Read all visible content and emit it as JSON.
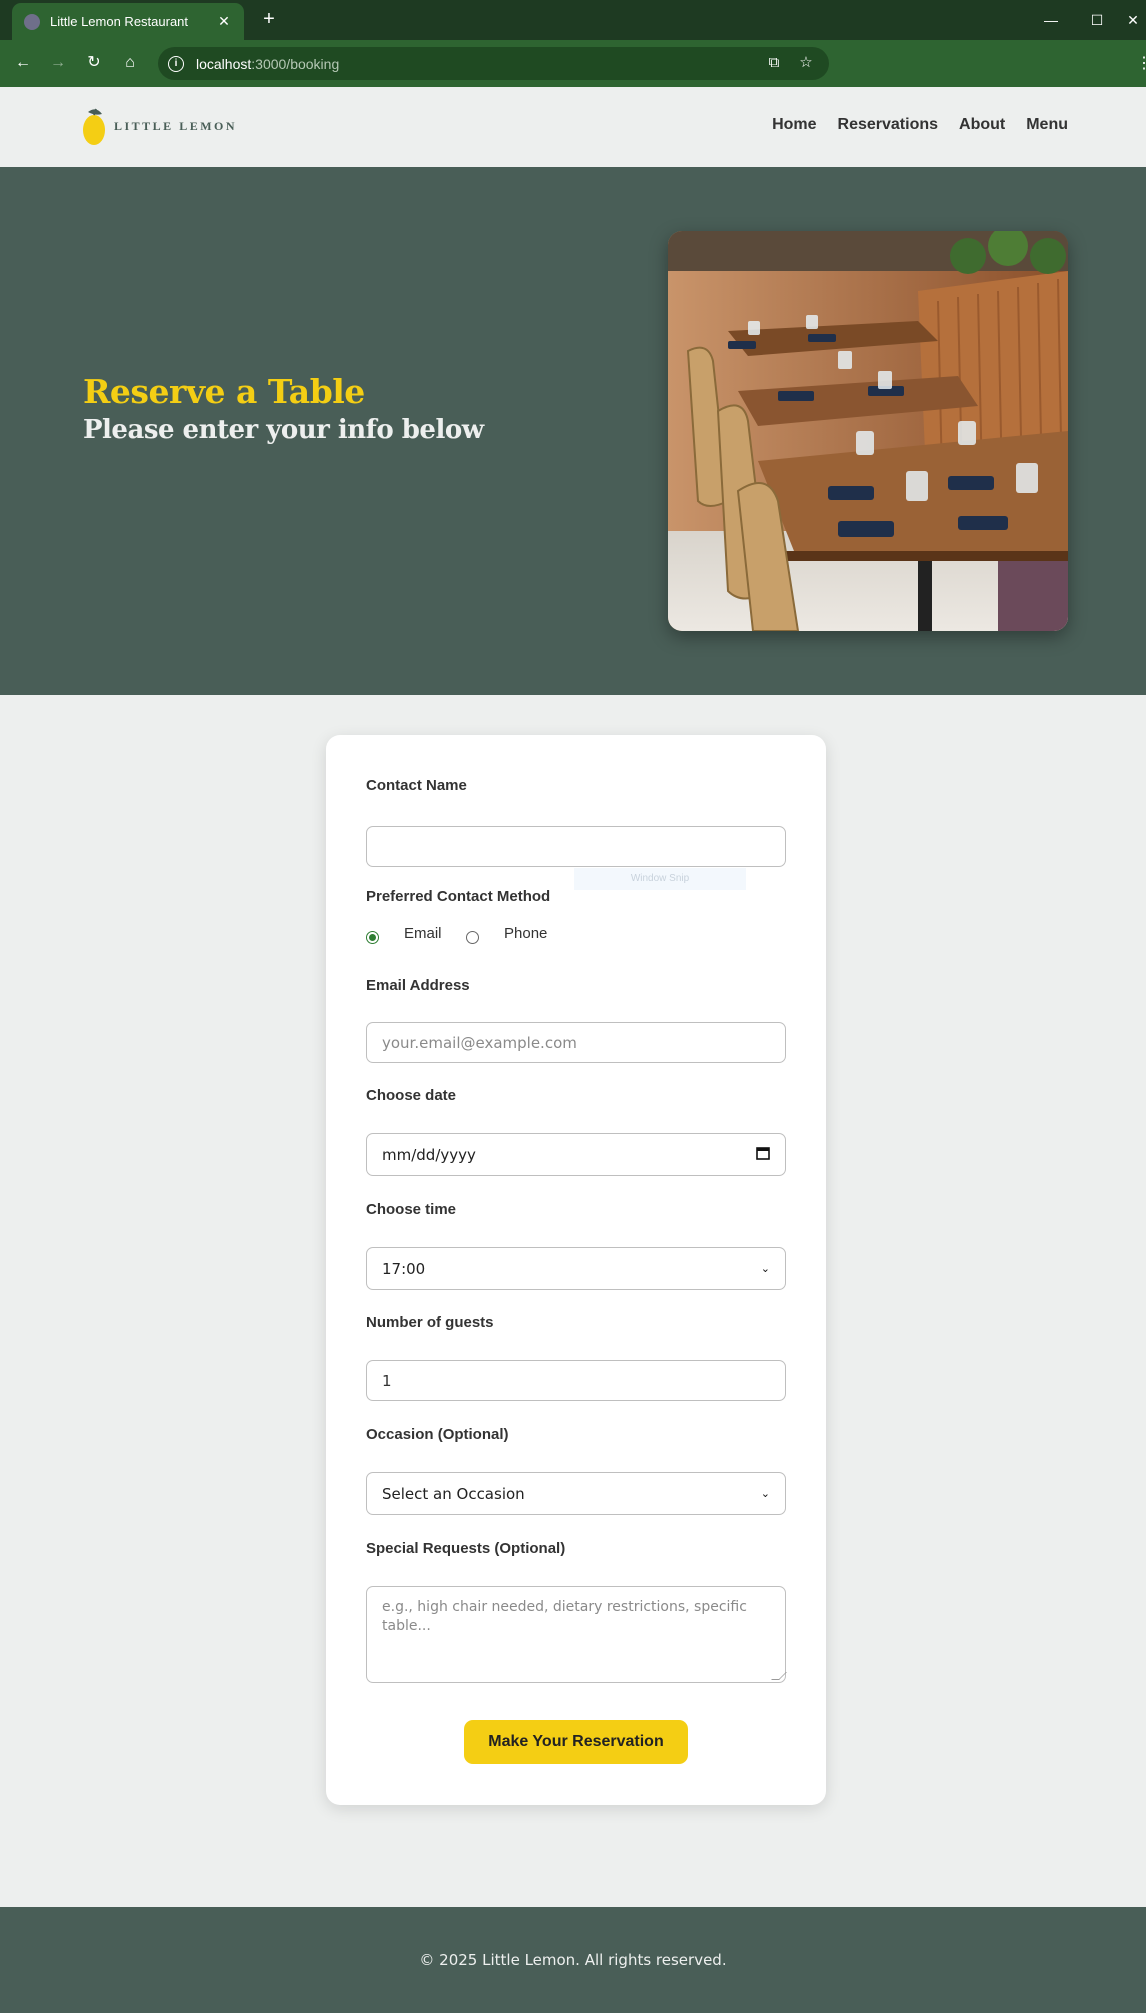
{
  "browser": {
    "tab_title": "Little Lemon Restaurant",
    "url_host": "localhost",
    "url_path": ":3000/booking"
  },
  "header": {
    "logo_text": "LITTLE LEMON",
    "nav": [
      "Home",
      "Reservations",
      "About",
      "Menu"
    ]
  },
  "hero": {
    "title": "Reserve a Table",
    "subtitle": "Please enter your info below"
  },
  "form": {
    "contact_name_label": "Contact Name",
    "contact_name_value": "",
    "contact_method_label": "Preferred Contact Method",
    "contact_method_options": [
      "Email",
      "Phone"
    ],
    "contact_method_selected": "Email",
    "email_label": "Email Address",
    "email_placeholder": "your.email@example.com",
    "date_label": "Choose date",
    "date_value": "mm/dd/yyyy",
    "time_label": "Choose time",
    "time_value": "17:00",
    "guests_label": "Number of guests",
    "guests_value": "1",
    "occasion_label": "Occasion (Optional)",
    "occasion_value": "Select an Occasion",
    "requests_label": "Special Requests (Optional)",
    "requests_placeholder": "e.g., high chair needed, dietary restrictions, specific table...",
    "submit_label": "Make Your Reservation"
  },
  "overlay": {
    "snip_text": "Window Snip"
  },
  "footer": {
    "copyright": "© 2025 Little Lemon. All rights reserved."
  },
  "colors": {
    "primary_green": "#495e57",
    "primary_yellow": "#f4ce14",
    "chrome_green": "#2e6431",
    "page_bg": "#edefee"
  }
}
